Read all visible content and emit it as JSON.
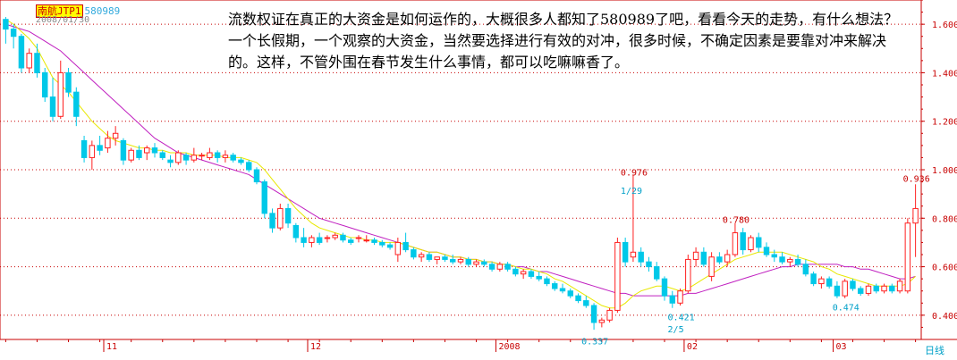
{
  "header": {
    "stock_name": "南航JTP1",
    "stock_code": "580989",
    "date": "2008/01/30"
  },
  "annotation_text": "流数权证在真正的大资金是如何运作的，大概很多人都知了580989了吧，看看今天的走势，有什么想法？一个长假期，一个观察的大资金，当然要选择进行有效的对冲，很多时候，不确定因素是要靠对冲来解决的。这样，不管外围在春节发生什么事情，都可以吃嘛嘛香了。",
  "period_label": "日线",
  "colors": {
    "up": "#ff2020",
    "down": "#00c8e8",
    "ma_short": "#e8e800",
    "ma_long": "#c020c0",
    "grid": "#c80000",
    "axis_text": "#c80000"
  },
  "chart_data": {
    "type": "candlestick",
    "title": "",
    "ylim": [
      0.3,
      1.7
    ],
    "y_ticks": [
      "1.600",
      "1.400",
      "1.200",
      "1.000",
      "0.800",
      "0.600",
      "0.400"
    ],
    "x_tick_labels": [
      "11",
      "12",
      "2008",
      "02",
      "03"
    ],
    "grid": true,
    "candles": [
      [
        1.62,
        1.63,
        1.52,
        1.58
      ],
      [
        1.58,
        1.6,
        1.5,
        1.55
      ],
      [
        1.55,
        1.56,
        1.4,
        1.42
      ],
      [
        1.42,
        1.5,
        1.4,
        1.48
      ],
      [
        1.48,
        1.52,
        1.38,
        1.4
      ],
      [
        1.4,
        1.42,
        1.28,
        1.3
      ],
      [
        1.3,
        1.38,
        1.2,
        1.22
      ],
      [
        1.22,
        1.45,
        1.21,
        1.4
      ],
      [
        1.4,
        1.42,
        1.3,
        1.32
      ],
      [
        1.32,
        1.34,
        1.18,
        1.22
      ],
      [
        1.12,
        1.14,
        1.03,
        1.05
      ],
      [
        1.05,
        1.12,
        1.0,
        1.1
      ],
      [
        1.1,
        1.14,
        1.06,
        1.08
      ],
      [
        1.09,
        1.16,
        1.07,
        1.13
      ],
      [
        1.13,
        1.18,
        1.1,
        1.15
      ],
      [
        1.12,
        1.13,
        1.02,
        1.04
      ],
      [
        1.04,
        1.09,
        1.03,
        1.08
      ],
      [
        1.08,
        1.1,
        1.04,
        1.05
      ],
      [
        1.07,
        1.1,
        1.04,
        1.09
      ],
      [
        1.09,
        1.11,
        1.05,
        1.07
      ],
      [
        1.07,
        1.08,
        1.04,
        1.05
      ],
      [
        1.04,
        1.06,
        1.01,
        1.03
      ],
      [
        1.03,
        1.08,
        1.02,
        1.07
      ],
      [
        1.06,
        1.07,
        1.02,
        1.04
      ],
      [
        1.04,
        1.09,
        1.03,
        1.06
      ],
      [
        1.06,
        1.07,
        1.04,
        1.06
      ],
      [
        1.05,
        1.09,
        1.04,
        1.07
      ],
      [
        1.07,
        1.08,
        1.03,
        1.05
      ],
      [
        1.05,
        1.08,
        1.03,
        1.06
      ],
      [
        1.06,
        1.07,
        1.03,
        1.04
      ],
      [
        1.04,
        1.05,
        1.02,
        1.03
      ],
      [
        1.03,
        1.04,
        0.99,
        1.0
      ],
      [
        1.0,
        1.01,
        0.94,
        0.95
      ],
      [
        0.95,
        0.96,
        0.8,
        0.82
      ],
      [
        0.82,
        0.84,
        0.74,
        0.76
      ],
      [
        0.76,
        0.86,
        0.75,
        0.84
      ],
      [
        0.84,
        0.86,
        0.76,
        0.78
      ],
      [
        0.77,
        0.78,
        0.7,
        0.72
      ],
      [
        0.72,
        0.76,
        0.68,
        0.7
      ],
      [
        0.7,
        0.73,
        0.68,
        0.72
      ],
      [
        0.72,
        0.74,
        0.69,
        0.7
      ],
      [
        0.72,
        0.73,
        0.7,
        0.72
      ],
      [
        0.72,
        0.74,
        0.71,
        0.73
      ],
      [
        0.73,
        0.74,
        0.7,
        0.71
      ],
      [
        0.71,
        0.72,
        0.69,
        0.7
      ],
      [
        0.72,
        0.73,
        0.7,
        0.72
      ],
      [
        0.71,
        0.73,
        0.7,
        0.71
      ],
      [
        0.71,
        0.72,
        0.69,
        0.7
      ],
      [
        0.7,
        0.71,
        0.68,
        0.69
      ],
      [
        0.69,
        0.7,
        0.67,
        0.68
      ],
      [
        0.65,
        0.72,
        0.62,
        0.7
      ],
      [
        0.7,
        0.74,
        0.66,
        0.67
      ],
      [
        0.67,
        0.68,
        0.63,
        0.64
      ],
      [
        0.64,
        0.66,
        0.62,
        0.65
      ],
      [
        0.65,
        0.66,
        0.62,
        0.63
      ],
      [
        0.63,
        0.64,
        0.61,
        0.64
      ],
      [
        0.64,
        0.65,
        0.62,
        0.63
      ],
      [
        0.63,
        0.65,
        0.61,
        0.62
      ],
      [
        0.62,
        0.64,
        0.61,
        0.63
      ],
      [
        0.63,
        0.64,
        0.6,
        0.61
      ],
      [
        0.61,
        0.63,
        0.6,
        0.62
      ],
      [
        0.62,
        0.63,
        0.6,
        0.61
      ],
      [
        0.61,
        0.62,
        0.58,
        0.59
      ],
      [
        0.59,
        0.62,
        0.58,
        0.61
      ],
      [
        0.61,
        0.62,
        0.58,
        0.59
      ],
      [
        0.59,
        0.6,
        0.56,
        0.57
      ],
      [
        0.57,
        0.59,
        0.55,
        0.58
      ],
      [
        0.58,
        0.59,
        0.55,
        0.56
      ],
      [
        0.56,
        0.58,
        0.54,
        0.55
      ],
      [
        0.55,
        0.56,
        0.52,
        0.53
      ],
      [
        0.53,
        0.54,
        0.5,
        0.51
      ],
      [
        0.51,
        0.53,
        0.49,
        0.5
      ],
      [
        0.5,
        0.51,
        0.47,
        0.48
      ],
      [
        0.48,
        0.49,
        0.45,
        0.46
      ],
      [
        0.46,
        0.48,
        0.43,
        0.44
      ],
      [
        0.44,
        0.45,
        0.34,
        0.37
      ],
      [
        0.37,
        0.39,
        0.35,
        0.38
      ],
      [
        0.38,
        0.43,
        0.37,
        0.42
      ],
      [
        0.42,
        0.72,
        0.41,
        0.7
      ],
      [
        0.7,
        0.72,
        0.6,
        0.62
      ],
      [
        0.64,
        0.98,
        0.62,
        0.66
      ],
      [
        0.66,
        0.68,
        0.6,
        0.62
      ],
      [
        0.62,
        0.64,
        0.58,
        0.6
      ],
      [
        0.6,
        0.62,
        0.54,
        0.55
      ],
      [
        0.55,
        0.56,
        0.46,
        0.48
      ],
      [
        0.48,
        0.5,
        0.43,
        0.45
      ],
      [
        0.45,
        0.51,
        0.44,
        0.5
      ],
      [
        0.5,
        0.65,
        0.49,
        0.63
      ],
      [
        0.63,
        0.68,
        0.6,
        0.66
      ],
      [
        0.66,
        0.68,
        0.6,
        0.61
      ],
      [
        0.56,
        0.66,
        0.54,
        0.64
      ],
      [
        0.64,
        0.66,
        0.61,
        0.62
      ],
      [
        0.62,
        0.67,
        0.6,
        0.65
      ],
      [
        0.65,
        0.78,
        0.64,
        0.74
      ],
      [
        0.74,
        0.76,
        0.65,
        0.67
      ],
      [
        0.67,
        0.73,
        0.66,
        0.72
      ],
      [
        0.72,
        0.74,
        0.66,
        0.68
      ],
      [
        0.68,
        0.7,
        0.64,
        0.65
      ],
      [
        0.65,
        0.67,
        0.62,
        0.64
      ],
      [
        0.64,
        0.66,
        0.61,
        0.62
      ],
      [
        0.62,
        0.64,
        0.6,
        0.63
      ],
      [
        0.63,
        0.65,
        0.6,
        0.61
      ],
      [
        0.61,
        0.63,
        0.56,
        0.57
      ],
      [
        0.57,
        0.58,
        0.52,
        0.53
      ],
      [
        0.53,
        0.56,
        0.51,
        0.55
      ],
      [
        0.55,
        0.56,
        0.51,
        0.52
      ],
      [
        0.52,
        0.54,
        0.47,
        0.48
      ],
      [
        0.48,
        0.55,
        0.47,
        0.54
      ],
      [
        0.54,
        0.55,
        0.5,
        0.51
      ],
      [
        0.51,
        0.52,
        0.48,
        0.49
      ],
      [
        0.49,
        0.53,
        0.48,
        0.52
      ],
      [
        0.52,
        0.53,
        0.49,
        0.5
      ],
      [
        0.5,
        0.53,
        0.49,
        0.52
      ],
      [
        0.52,
        0.53,
        0.49,
        0.5
      ],
      [
        0.5,
        0.55,
        0.49,
        0.54
      ],
      [
        0.5,
        0.8,
        0.49,
        0.78
      ],
      [
        0.78,
        0.94,
        0.64,
        0.84
      ]
    ],
    "ma_short": [
      1.62,
      1.6,
      1.57,
      1.54,
      1.5,
      1.44,
      1.38,
      1.35,
      1.32,
      1.28,
      1.24,
      1.2,
      1.17,
      1.14,
      1.12,
      1.11,
      1.1,
      1.09,
      1.09,
      1.08,
      1.08,
      1.07,
      1.07,
      1.07,
      1.06,
      1.06,
      1.06,
      1.06,
      1.05,
      1.05,
      1.05,
      1.04,
      1.03,
      1.0,
      0.96,
      0.92,
      0.88,
      0.84,
      0.81,
      0.78,
      0.76,
      0.75,
      0.74,
      0.73,
      0.72,
      0.72,
      0.71,
      0.71,
      0.7,
      0.7,
      0.7,
      0.69,
      0.68,
      0.67,
      0.66,
      0.66,
      0.65,
      0.64,
      0.64,
      0.63,
      0.63,
      0.62,
      0.62,
      0.61,
      0.61,
      0.6,
      0.59,
      0.59,
      0.58,
      0.57,
      0.55,
      0.54,
      0.52,
      0.5,
      0.48,
      0.46,
      0.44,
      0.43,
      0.43,
      0.45,
      0.48,
      0.5,
      0.51,
      0.52,
      0.52,
      0.51,
      0.5,
      0.51,
      0.53,
      0.55,
      0.57,
      0.59,
      0.61,
      0.63,
      0.64,
      0.65,
      0.66,
      0.66,
      0.66,
      0.66,
      0.65,
      0.64,
      0.63,
      0.62,
      0.6,
      0.59,
      0.57,
      0.56,
      0.55,
      0.54,
      0.53,
      0.52,
      0.52,
      0.52,
      0.52,
      0.53,
      0.56
    ],
    "ma_long": [
      1.6,
      1.59,
      1.58,
      1.57,
      1.55,
      1.53,
      1.51,
      1.49,
      1.46,
      1.43,
      1.4,
      1.37,
      1.34,
      1.31,
      1.28,
      1.25,
      1.22,
      1.19,
      1.16,
      1.13,
      1.11,
      1.09,
      1.07,
      1.06,
      1.05,
      1.04,
      1.03,
      1.02,
      1.01,
      1.0,
      0.99,
      0.98,
      0.96,
      0.94,
      0.92,
      0.9,
      0.88,
      0.86,
      0.84,
      0.82,
      0.8,
      0.79,
      0.78,
      0.77,
      0.76,
      0.75,
      0.74,
      0.73,
      0.72,
      0.71,
      0.7,
      0.69,
      0.68,
      0.67,
      0.66,
      0.66,
      0.65,
      0.64,
      0.64,
      0.63,
      0.63,
      0.62,
      0.62,
      0.61,
      0.61,
      0.6,
      0.6,
      0.59,
      0.58,
      0.58,
      0.57,
      0.56,
      0.55,
      0.54,
      0.53,
      0.52,
      0.51,
      0.5,
      0.49,
      0.49,
      0.48,
      0.48,
      0.48,
      0.48,
      0.48,
      0.48,
      0.48,
      0.49,
      0.49,
      0.5,
      0.51,
      0.52,
      0.53,
      0.54,
      0.55,
      0.56,
      0.57,
      0.58,
      0.59,
      0.6,
      0.6,
      0.61,
      0.61,
      0.61,
      0.61,
      0.61,
      0.61,
      0.6,
      0.6,
      0.59,
      0.59,
      0.58,
      0.57,
      0.56,
      0.55,
      0.55,
      0.56
    ],
    "annotations": [
      {
        "text": "0.976",
        "at": 80,
        "value": 0.976,
        "color": "#c80000"
      },
      {
        "text": "1/29",
        "at": 80,
        "value": 0.9,
        "color": "#00a0c8"
      },
      {
        "text": "0.780",
        "at": 93,
        "value": 0.78,
        "color": "#c80000"
      },
      {
        "text": "0.421",
        "at": 86,
        "value": 0.38,
        "color": "#00a0c8"
      },
      {
        "text": "2/5",
        "at": 86,
        "value": 0.33,
        "color": "#00a0c8"
      },
      {
        "text": "0.337",
        "at": 75,
        "value": 0.28,
        "color": "#00a0c8"
      },
      {
        "text": "0.474",
        "at": 107,
        "value": 0.42,
        "color": "#00a0c8"
      },
      {
        "text": "0.936",
        "at": 116,
        "value": 0.95,
        "color": "#c80000"
      }
    ],
    "x_tick_positions": [
      13,
      39,
      63,
      87,
      106
    ]
  }
}
